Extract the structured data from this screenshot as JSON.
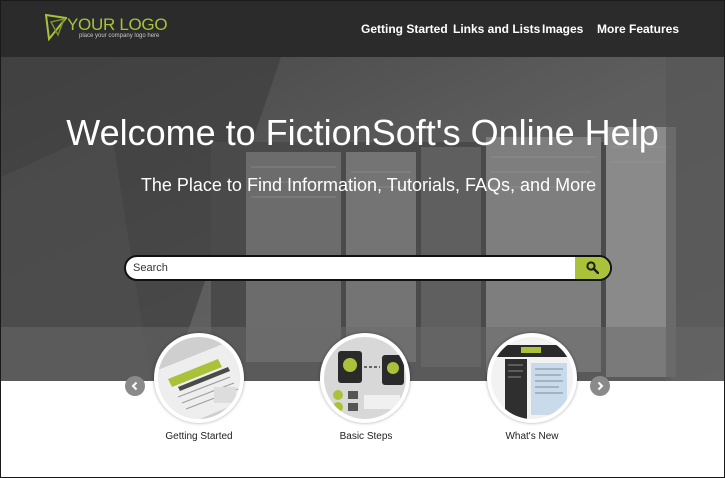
{
  "logo": {
    "name": "YOUR LOGO",
    "tagline": "place your company logo here"
  },
  "nav": {
    "items": [
      {
        "label": "Getting Started"
      },
      {
        "label": "Links and Lists"
      },
      {
        "label": "Images"
      },
      {
        "label": "More Features"
      }
    ]
  },
  "hero": {
    "title": "Welcome to FictionSoft's Online Help",
    "subtitle": "The Place to Find Information, Tutorials, FAQs, and More"
  },
  "search": {
    "placeholder": "Search",
    "value": ""
  },
  "carousel": {
    "items": [
      {
        "label": "Getting Started"
      },
      {
        "label": "Basic Steps"
      },
      {
        "label": "What's New"
      }
    ]
  },
  "colors": {
    "accent": "#a9c23a",
    "header_bg": "#2b2b2b",
    "hero_bg": "#5a5a5a"
  },
  "icons": {
    "logo": "logo-mark-icon",
    "search": "magnifier-icon",
    "prev": "chevron-left-icon",
    "next": "chevron-right-icon"
  }
}
